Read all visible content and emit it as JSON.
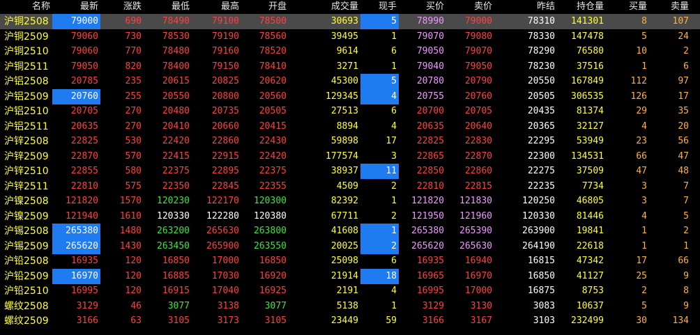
{
  "colors": {
    "up": "#ff4040",
    "down": "#3ce63c",
    "flat": "#ffffff",
    "volume": "#ffff33",
    "open_interest": "#ffff33",
    "bid_ask_volume": "#ffb23d",
    "bid_price": "#ee99ff",
    "highlight": "#1e7bf0",
    "selected_row": "#4a4a4a",
    "background": "#000000"
  },
  "headers": {
    "name": "名称",
    "last": "最新",
    "change": "涨跌",
    "low": "最低",
    "high": "最高",
    "open": "开盘",
    "volume": "成交量",
    "current_volume": "现手",
    "bid": "买价",
    "ask": "卖价",
    "prev_settle": "昨结",
    "open_interest": "持仓量",
    "bid_volume": "买量",
    "ask_volume": "卖量"
  },
  "rows": [
    {
      "name": "沪铜2508",
      "last": "79000",
      "change": "690",
      "low": "78490",
      "high": "79100",
      "open": "78500",
      "volume": "30693",
      "current_volume": "5",
      "bid": "78990",
      "ask": "79000",
      "prev_settle": "78310",
      "open_interest": "141301",
      "bid_volume": "8",
      "ask_volume": "107"
    },
    {
      "name": "沪铜2509",
      "last": "79060",
      "change": "730",
      "low": "78530",
      "high": "79190",
      "open": "78560",
      "volume": "39495",
      "current_volume": "1",
      "bid": "79070",
      "ask": "79080",
      "prev_settle": "78330",
      "open_interest": "147478",
      "bid_volume": "5",
      "ask_volume": "24"
    },
    {
      "name": "沪铜2510",
      "last": "79060",
      "change": "770",
      "low": "78480",
      "high": "79160",
      "open": "78520",
      "volume": "9614",
      "current_volume": "6",
      "bid": "79050",
      "ask": "79070",
      "prev_settle": "78290",
      "open_interest": "76580",
      "bid_volume": "10",
      "ask_volume": "2"
    },
    {
      "name": "沪铜2511",
      "last": "79050",
      "change": "820",
      "low": "78400",
      "high": "79150",
      "open": "78410",
      "volume": "3271",
      "current_volume": "1",
      "bid": "79040",
      "ask": "79050",
      "prev_settle": "78230",
      "open_interest": "37516",
      "bid_volume": "1",
      "ask_volume": "6"
    },
    {
      "name": "沪铝2508",
      "last": "20785",
      "change": "235",
      "low": "20615",
      "high": "20825",
      "open": "20620",
      "volume": "45300",
      "current_volume": "5",
      "bid": "20780",
      "ask": "20790",
      "prev_settle": "20550",
      "open_interest": "167849",
      "bid_volume": "112",
      "ask_volume": "97"
    },
    {
      "name": "沪铝2509",
      "last": "20760",
      "change": "255",
      "low": "20550",
      "high": "20800",
      "open": "20560",
      "volume": "129345",
      "current_volume": "4",
      "bid": "20755",
      "ask": "20760",
      "prev_settle": "20505",
      "open_interest": "306535",
      "bid_volume": "126",
      "ask_volume": "17"
    },
    {
      "name": "沪铝2510",
      "last": "20705",
      "change": "270",
      "low": "20480",
      "high": "20735",
      "open": "20505",
      "volume": "27513",
      "current_volume": "6",
      "bid": "20700",
      "ask": "20705",
      "prev_settle": "20435",
      "open_interest": "81374",
      "bid_volume": "29",
      "ask_volume": "35"
    },
    {
      "name": "沪铝2511",
      "last": "20635",
      "change": "270",
      "low": "20410",
      "high": "20660",
      "open": "20415",
      "volume": "8894",
      "current_volume": "4",
      "bid": "20635",
      "ask": "20640",
      "prev_settle": "20365",
      "open_interest": "32127",
      "bid_volume": "4",
      "ask_volume": "20"
    },
    {
      "name": "沪锌2508",
      "last": "22825",
      "change": "530",
      "low": "22420",
      "high": "22860",
      "open": "22430",
      "volume": "59898",
      "current_volume": "17",
      "bid": "22825",
      "ask": "22830",
      "prev_settle": "22295",
      "open_interest": "53949",
      "bid_volume": "23",
      "ask_volume": "56"
    },
    {
      "name": "沪锌2509",
      "last": "22870",
      "change": "570",
      "low": "22415",
      "high": "22915",
      "open": "22420",
      "volume": "177574",
      "current_volume": "3",
      "bid": "22865",
      "ask": "22870",
      "prev_settle": "22300",
      "open_interest": "134531",
      "bid_volume": "66",
      "ask_volume": "47"
    },
    {
      "name": "沪锌2510",
      "last": "22855",
      "change": "580",
      "low": "22375",
      "high": "22895",
      "open": "22375",
      "volume": "38937",
      "current_volume": "11",
      "bid": "22850",
      "ask": "22860",
      "prev_settle": "22275",
      "open_interest": "37509",
      "bid_volume": "47",
      "ask_volume": "48"
    },
    {
      "name": "沪锌2511",
      "last": "22810",
      "change": "575",
      "low": "22350",
      "high": "22845",
      "open": "22355",
      "volume": "4509",
      "current_volume": "2",
      "bid": "22810",
      "ask": "22815",
      "prev_settle": "22235",
      "open_interest": "7734",
      "bid_volume": "3",
      "ask_volume": "7"
    },
    {
      "name": "沪镍2508",
      "last": "121820",
      "change": "1570",
      "low": "120230",
      "high": "122170",
      "open": "120300",
      "volume": "82392",
      "current_volume": "1",
      "bid": "121820",
      "ask": "121830",
      "prev_settle": "120250",
      "open_interest": "46805",
      "bid_volume": "3",
      "ask_volume": "7"
    },
    {
      "name": "沪镍2509",
      "last": "121940",
      "change": "1610",
      "low": "120330",
      "high": "122280",
      "open": "120380",
      "volume": "67711",
      "current_volume": "2",
      "bid": "121950",
      "ask": "121960",
      "prev_settle": "120330",
      "open_interest": "81446",
      "bid_volume": "4",
      "ask_volume": "5"
    },
    {
      "name": "沪锡2508",
      "last": "265380",
      "change": "1480",
      "low": "263200",
      "high": "265630",
      "open": "263800",
      "volume": "41608",
      "current_volume": "1",
      "bid": "265380",
      "ask": "265390",
      "prev_settle": "263900",
      "open_interest": "19841",
      "bid_volume": "1",
      "ask_volume": "2"
    },
    {
      "name": "沪锡2509",
      "last": "265620",
      "change": "1430",
      "low": "263450",
      "high": "265900",
      "open": "263550",
      "volume": "20025",
      "current_volume": "2",
      "bid": "265620",
      "ask": "265630",
      "prev_settle": "264190",
      "open_interest": "22618",
      "bid_volume": "1",
      "ask_volume": "1"
    },
    {
      "name": "沪铅2508",
      "last": "16935",
      "change": "120",
      "low": "16850",
      "high": "17000",
      "open": "16850",
      "volume": "25098",
      "current_volume": "6",
      "bid": "16935",
      "ask": "16940",
      "prev_settle": "16815",
      "open_interest": "47342",
      "bid_volume": "17",
      "ask_volume": "66"
    },
    {
      "name": "沪铅2509",
      "last": "16970",
      "change": "120",
      "low": "16885",
      "high": "17030",
      "open": "16920",
      "volume": "21914",
      "current_volume": "18",
      "bid": "16965",
      "ask": "16970",
      "prev_settle": "16850",
      "open_interest": "41127",
      "bid_volume": "25",
      "ask_volume": "9"
    },
    {
      "name": "沪铅2510",
      "last": "16995",
      "change": "120",
      "low": "16915",
      "high": "17040",
      "open": "16925",
      "volume": "2191",
      "current_volume": "4",
      "bid": "16995",
      "ask": "17000",
      "prev_settle": "16875",
      "open_interest": "8753",
      "bid_volume": "2",
      "ask_volume": "8"
    },
    {
      "name": "螺纹2508",
      "last": "3129",
      "change": "46",
      "low": "3077",
      "high": "3138",
      "open": "3077",
      "volume": "5138",
      "current_volume": "1",
      "bid": "3129",
      "ask": "3130",
      "prev_settle": "3083",
      "open_interest": "10637",
      "bid_volume": "5",
      "ask_volume": "9"
    },
    {
      "name": "螺纹2509",
      "last": "3166",
      "change": "63",
      "low": "3105",
      "high": "3173",
      "open": "3105",
      "volume": "23449",
      "current_volume": "59",
      "bid": "3166",
      "ask": "3167",
      "prev_settle": "3103",
      "open_interest": "232499",
      "bid_volume": "30",
      "ask_volume": "134"
    }
  ]
}
